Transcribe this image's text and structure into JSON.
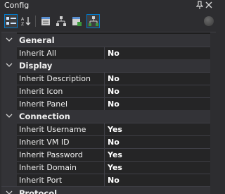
{
  "window": {
    "title": "Config",
    "pin_glyph": "⨁",
    "close_glyph": "✕"
  },
  "toolbar": {
    "buttons": [
      {
        "icon": "categorized-icon",
        "active": true
      },
      {
        "icon": "alphabetical-sort-icon",
        "active": false
      },
      {
        "icon": "properties-icon",
        "active": false
      },
      {
        "icon": "inheritance-tree-icon",
        "active": false
      },
      {
        "icon": "default-inheritance-icon",
        "active": false
      },
      {
        "icon": "connection-tree-icon",
        "active": true
      }
    ]
  },
  "categories": [
    {
      "label": "General",
      "rows": [
        {
          "name": "Inherit All",
          "value": "No"
        }
      ]
    },
    {
      "label": "Display",
      "rows": [
        {
          "name": "Inherit Description",
          "value": "No"
        },
        {
          "name": "Inherit Icon",
          "value": "No"
        },
        {
          "name": "Inherit Panel",
          "value": "No"
        }
      ]
    },
    {
      "label": "Connection",
      "rows": [
        {
          "name": "Inherit Username",
          "value": "Yes"
        },
        {
          "name": "Inherit VM ID",
          "value": "No"
        },
        {
          "name": "Inherit Password",
          "value": "Yes"
        },
        {
          "name": "Inherit Domain",
          "value": "Yes"
        },
        {
          "name": "Inherit Port",
          "value": "No"
        }
      ]
    },
    {
      "label": "Protocol",
      "rows": []
    }
  ],
  "colors": {
    "accent": "#007acc",
    "background": "#1e1e1e",
    "category_bg": "#333337",
    "row_bg": "#252526"
  }
}
